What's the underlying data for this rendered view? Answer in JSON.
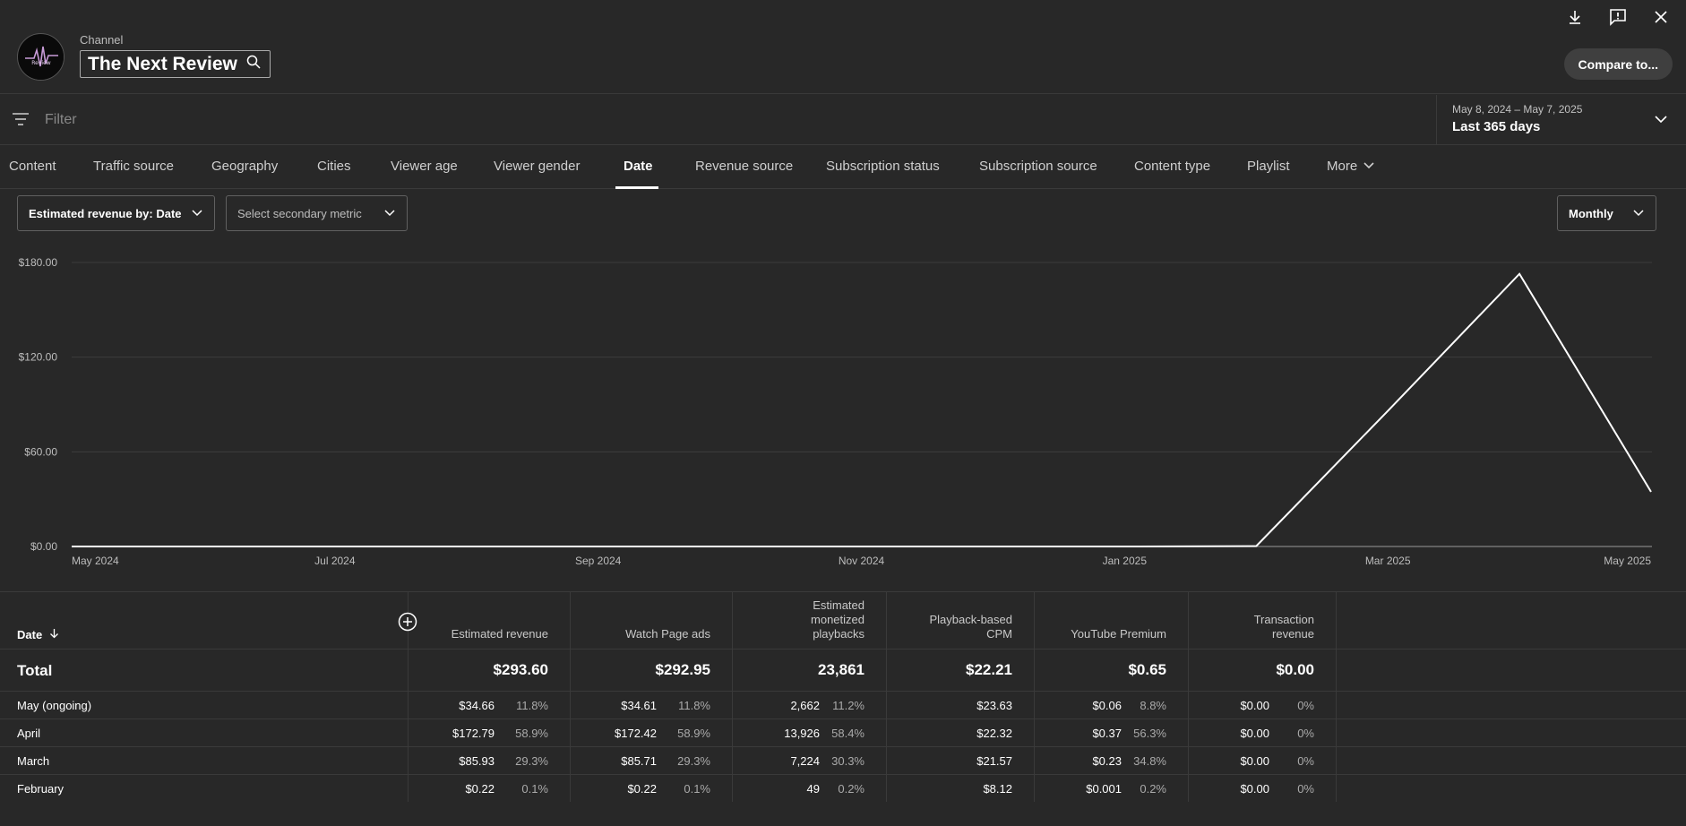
{
  "header": {
    "channel_label": "Channel",
    "channel_name": "The Next Review",
    "compare_label": "Compare to...",
    "icons": [
      "download-icon",
      "feedback-icon",
      "close-icon"
    ]
  },
  "filter": {
    "placeholder": "Filter",
    "date_range_sub": "May 8, 2024 – May 7, 2025",
    "date_range_main": "Last 365 days"
  },
  "tabs": [
    {
      "label": "Content"
    },
    {
      "label": "Traffic source"
    },
    {
      "label": "Geography"
    },
    {
      "label": "Cities"
    },
    {
      "label": "Viewer age"
    },
    {
      "label": "Viewer gender"
    },
    {
      "label": "Date",
      "active": true
    },
    {
      "label": "Revenue source"
    },
    {
      "label": "Subscription status"
    },
    {
      "label": "Subscription source"
    },
    {
      "label": "Content type"
    },
    {
      "label": "Playlist"
    },
    {
      "label": "More"
    }
  ],
  "metrics": {
    "primary": "Estimated revenue by: Date",
    "secondary": "Select secondary metric",
    "period": "Monthly"
  },
  "chart_data": {
    "type": "line",
    "x": [
      "2024-05",
      "2024-06",
      "2024-07",
      "2024-08",
      "2024-09",
      "2024-10",
      "2024-11",
      "2024-12",
      "2025-01",
      "2025-02",
      "2025-03",
      "2025-04",
      "2025-05"
    ],
    "series": [
      {
        "values": [
          0,
          0,
          0,
          0,
          0,
          0,
          0,
          0,
          0,
          0.22,
          85.93,
          172.79,
          34.66
        ]
      }
    ],
    "y_ticks": [
      "$0.00",
      "$60.00",
      "$120.00",
      "$180.00"
    ],
    "ylim": [
      0,
      180
    ],
    "x_tick_labels": [
      "May 2024",
      "Jul 2024",
      "Sep 2024",
      "Nov 2024",
      "Jan 2025",
      "Mar 2025",
      "May 2025"
    ],
    "grid": true,
    "line_color": "#ffffff"
  },
  "table": {
    "date_header": "Date",
    "columns": [
      "Estimated revenue",
      "Watch Page ads",
      "Estimated monetized playbacks",
      "Playback-based CPM",
      "YouTube Premium",
      "Transaction revenue"
    ],
    "total": {
      "label": "Total",
      "values": [
        "$293.60",
        "$292.95",
        "23,861",
        "$22.21",
        "$0.65",
        "$0.00"
      ]
    },
    "rows": [
      {
        "label": "May (ongoing)",
        "cells": [
          [
            "$34.66",
            "11.8%"
          ],
          [
            "$34.61",
            "11.8%"
          ],
          [
            "2,662",
            "11.2%"
          ],
          [
            "$23.63",
            ""
          ],
          [
            "$0.06",
            "8.8%"
          ],
          [
            "$0.00",
            "0%"
          ]
        ]
      },
      {
        "label": "April",
        "cells": [
          [
            "$172.79",
            "58.9%"
          ],
          [
            "$172.42",
            "58.9%"
          ],
          [
            "13,926",
            "58.4%"
          ],
          [
            "$22.32",
            ""
          ],
          [
            "$0.37",
            "56.3%"
          ],
          [
            "$0.00",
            "0%"
          ]
        ]
      },
      {
        "label": "March",
        "cells": [
          [
            "$85.93",
            "29.3%"
          ],
          [
            "$85.71",
            "29.3%"
          ],
          [
            "7,224",
            "30.3%"
          ],
          [
            "$21.57",
            ""
          ],
          [
            "$0.23",
            "34.8%"
          ],
          [
            "$0.00",
            "0%"
          ]
        ]
      },
      {
        "label": "February",
        "cells": [
          [
            "$0.22",
            "0.1%"
          ],
          [
            "$0.22",
            "0.1%"
          ],
          [
            "49",
            "0.2%"
          ],
          [
            "$8.12",
            ""
          ],
          [
            "$0.001",
            "0.2%"
          ],
          [
            "$0.00",
            "0%"
          ]
        ]
      }
    ]
  }
}
